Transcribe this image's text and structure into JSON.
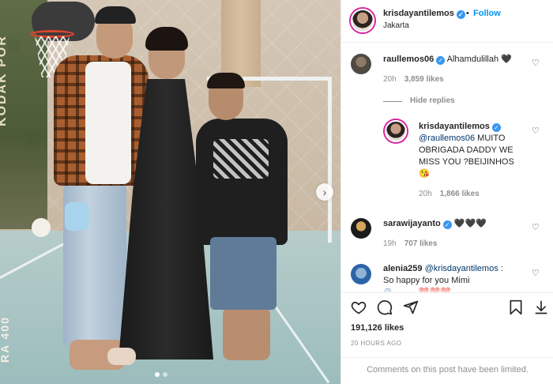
{
  "post": {
    "author": "krisdayantilemos",
    "follow_label": "Follow",
    "location": "Jakarta",
    "more_label": "···",
    "photo_labels": {
      "banner": "KODAK POR",
      "corner": "RA 400"
    },
    "carousel": {
      "dots": 2,
      "active": 1,
      "next_icon": "chevron-right-icon"
    }
  },
  "comments": [
    {
      "user": "raullemos06",
      "verified": true,
      "text": "Alhamdulillah 🖤",
      "time": "20h",
      "likes": "3,859 likes",
      "hide_replies": "Hide replies"
    },
    {
      "user": "krisdayantilemos",
      "verified": true,
      "mention": "@raullemos06",
      "text": " MUITO OBRIGADA DADDY WE MISS YOU ?BEIJINHOS",
      "emoji": "😘",
      "time": "20h",
      "likes": "1,866 likes"
    },
    {
      "user": "sarawijayanto",
      "verified": true,
      "text": "🖤🖤🖤",
      "time": "19h",
      "likes": "707 likes"
    },
    {
      "user": "alenia259",
      "verified": false,
      "mention": "@krisdayantilemos",
      "text": " :",
      "line2": "So happy for you Mimi",
      "line3": "@...........❤️❤️❤️"
    }
  ],
  "actions": {
    "like_icon": "heart-icon",
    "comment_icon": "comment-icon",
    "share_icon": "share-icon",
    "save_icon": "bookmark-icon",
    "likes": "191,126 likes",
    "date": "20 HOURS AGO"
  },
  "comments_limited": "Comments on this post have been limited."
}
